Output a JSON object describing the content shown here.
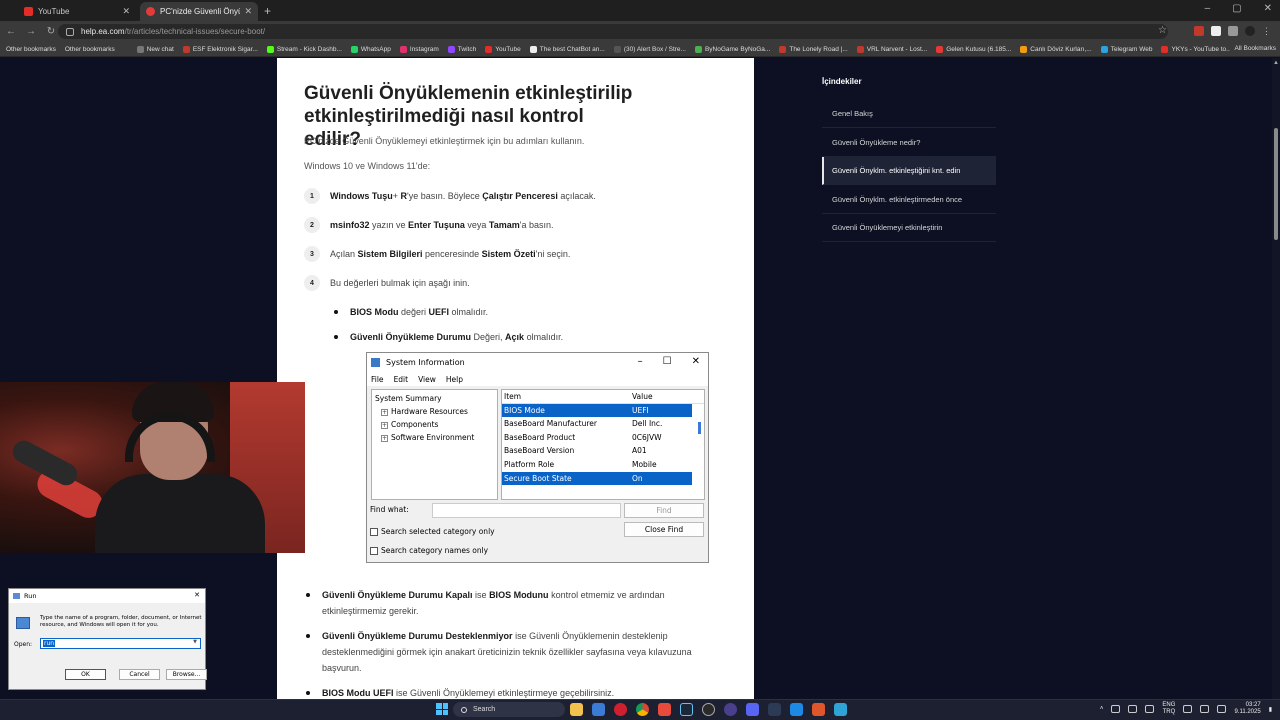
{
  "browser": {
    "tabs": [
      {
        "label": "YouTube",
        "active": false
      },
      {
        "label": "PC'nizde Güvenli Önyükleme n",
        "active": true
      }
    ],
    "new_tab": "+",
    "url_host": "help.ea.com",
    "url_path": "/tr/articles/technical-issues/secure-boot/",
    "bookmarks": [
      "Other bookmarks",
      "Other bookmarks",
      "New chat",
      "ESF Elektronik Sigar...",
      "Stream - Kick Dashb...",
      "WhatsApp",
      "Instagram",
      "Twitch",
      "YouTube",
      "The best ChatBot an...",
      "(30) Alert Box / Stre...",
      "ByNoGame ByNoGa...",
      "The Lonely Road |...",
      "VRL Narvent - Lost...",
      "Gelen Kutusu (6.185...",
      "Canlı Döviz Kurları,...",
      "Telegram Web",
      "YKYs - YouTube to..."
    ],
    "all_bookmarks": "All Bookmarks"
  },
  "article": {
    "heading": "Güvenli Önyüklemenin etkinleştirilip etkinleştirilmediği nasıl kontrol edilir?",
    "intro": "PC'nizde Güvenli Önyüklemeyi etkinleştirmek için bu adımları kullanın.",
    "os": "Windows 10 ve Windows 11'de:",
    "steps": [
      {
        "num": "1",
        "b1": "Windows Tuşu",
        "t1": "+ ",
        "b2": "R",
        "t2": "'ye basın. Böylece ",
        "b3": "Çalıştır Penceresi",
        "t3": " açılacak."
      },
      {
        "num": "2",
        "b1": "msinfo32",
        "t1": " yazın ve ",
        "b2": "Enter Tuşuna",
        "t2": " veya ",
        "b3": "Tamam",
        "t3": "'a basın."
      },
      {
        "num": "3",
        "t0": "Açılan ",
        "b1": "Sistem Bilgileri",
        "t1": " penceresinde ",
        "b2": "Sistem Özeti",
        "t2": "'ni seçin."
      },
      {
        "num": "4",
        "t0": "Bu değerleri bulmak için aşağı inin."
      }
    ],
    "sub_bullets": [
      {
        "b1": "BIOS Modu",
        "t1": " değeri ",
        "b2": "UEFI",
        "t2": " olmalıdır."
      },
      {
        "b1": "Güvenli Önyükleme Durumu",
        "t1": " Değeri, ",
        "b2": "Açık",
        "t2": " olmalıdır."
      }
    ],
    "bottom_bullets": [
      {
        "b1": "Güvenli Önyükleme Durumu Kapalı",
        "t1": " ise ",
        "b2": "BIOS Modunu",
        "t2": " kontrol etmemiz ve ardından etkinleştirmemiz gerekir."
      },
      {
        "b1": "Güvenli Önyükleme Durumu Desteklenmiyor",
        "t1": " ise Güvenli Önyüklemenin desteklenip desteklenmediğini görmek için anakart üreticinizin teknik özellikler sayfasına veya kılavuzuna başvurun.",
        "b2": "",
        "t2": ""
      },
      {
        "b1": "BIOS Modu UEFI",
        "t1": " ise Güvenli Önyüklemeyi etkinleştirmeye geçebilirsiniz.",
        "b2": "",
        "t2": ""
      }
    ]
  },
  "sysinfo": {
    "title": "System Information",
    "menu": [
      "File",
      "Edit",
      "View",
      "Help"
    ],
    "tree": [
      "System Summary",
      "Hardware Resources",
      "Components",
      "Software Environment"
    ],
    "col_item": "Item",
    "col_value": "Value",
    "rows": [
      {
        "item": "BIOS Mode",
        "value": "UEFI",
        "selected": true
      },
      {
        "item": "BaseBoard Manufacturer",
        "value": "Dell Inc.",
        "selected": false
      },
      {
        "item": "BaseBoard Product",
        "value": "0C6JVW",
        "selected": false
      },
      {
        "item": "BaseBoard Version",
        "value": "A01",
        "selected": false
      },
      {
        "item": "Platform Role",
        "value": "Mobile",
        "selected": false
      },
      {
        "item": "Secure Boot State",
        "value": "On",
        "selected": true
      }
    ],
    "find_label": "Find what:",
    "find_button": "Find",
    "close_find": "Close Find",
    "check1": "Search selected category only",
    "check2": "Search category names only"
  },
  "toc": {
    "title": "İçindekiler",
    "items": [
      {
        "label": "Genel Bakış",
        "active": false
      },
      {
        "label": "Güvenli Önyükleme nedir?",
        "active": false
      },
      {
        "label": "Güvenli Önyklm. etkinleştiğini knt. edin",
        "active": true
      },
      {
        "label": "Güvenli Önyklm. etkinleştirmeden önce",
        "active": false
      },
      {
        "label": "Güvenli Önyüklemeyi etkinleştirin",
        "active": false
      }
    ]
  },
  "run_dialog": {
    "title": "Run",
    "close": "✕",
    "description": "Type the name of a program, folder, document, or Internet resource, and Windows will open it for you.",
    "open_label": "Open:",
    "open_value": "run",
    "ok": "OK",
    "cancel": "Cancel",
    "browse": "Browse..."
  },
  "taskbar": {
    "search_placeholder": "Search",
    "lang_top": "ENG",
    "lang_bottom": "TRQ",
    "time": "03:27",
    "date": "9.11.2025"
  },
  "colors": {
    "page_bg": "#0c1022",
    "selection_blue": "#0a64c8",
    "accent_start": "#4cc2ff"
  }
}
